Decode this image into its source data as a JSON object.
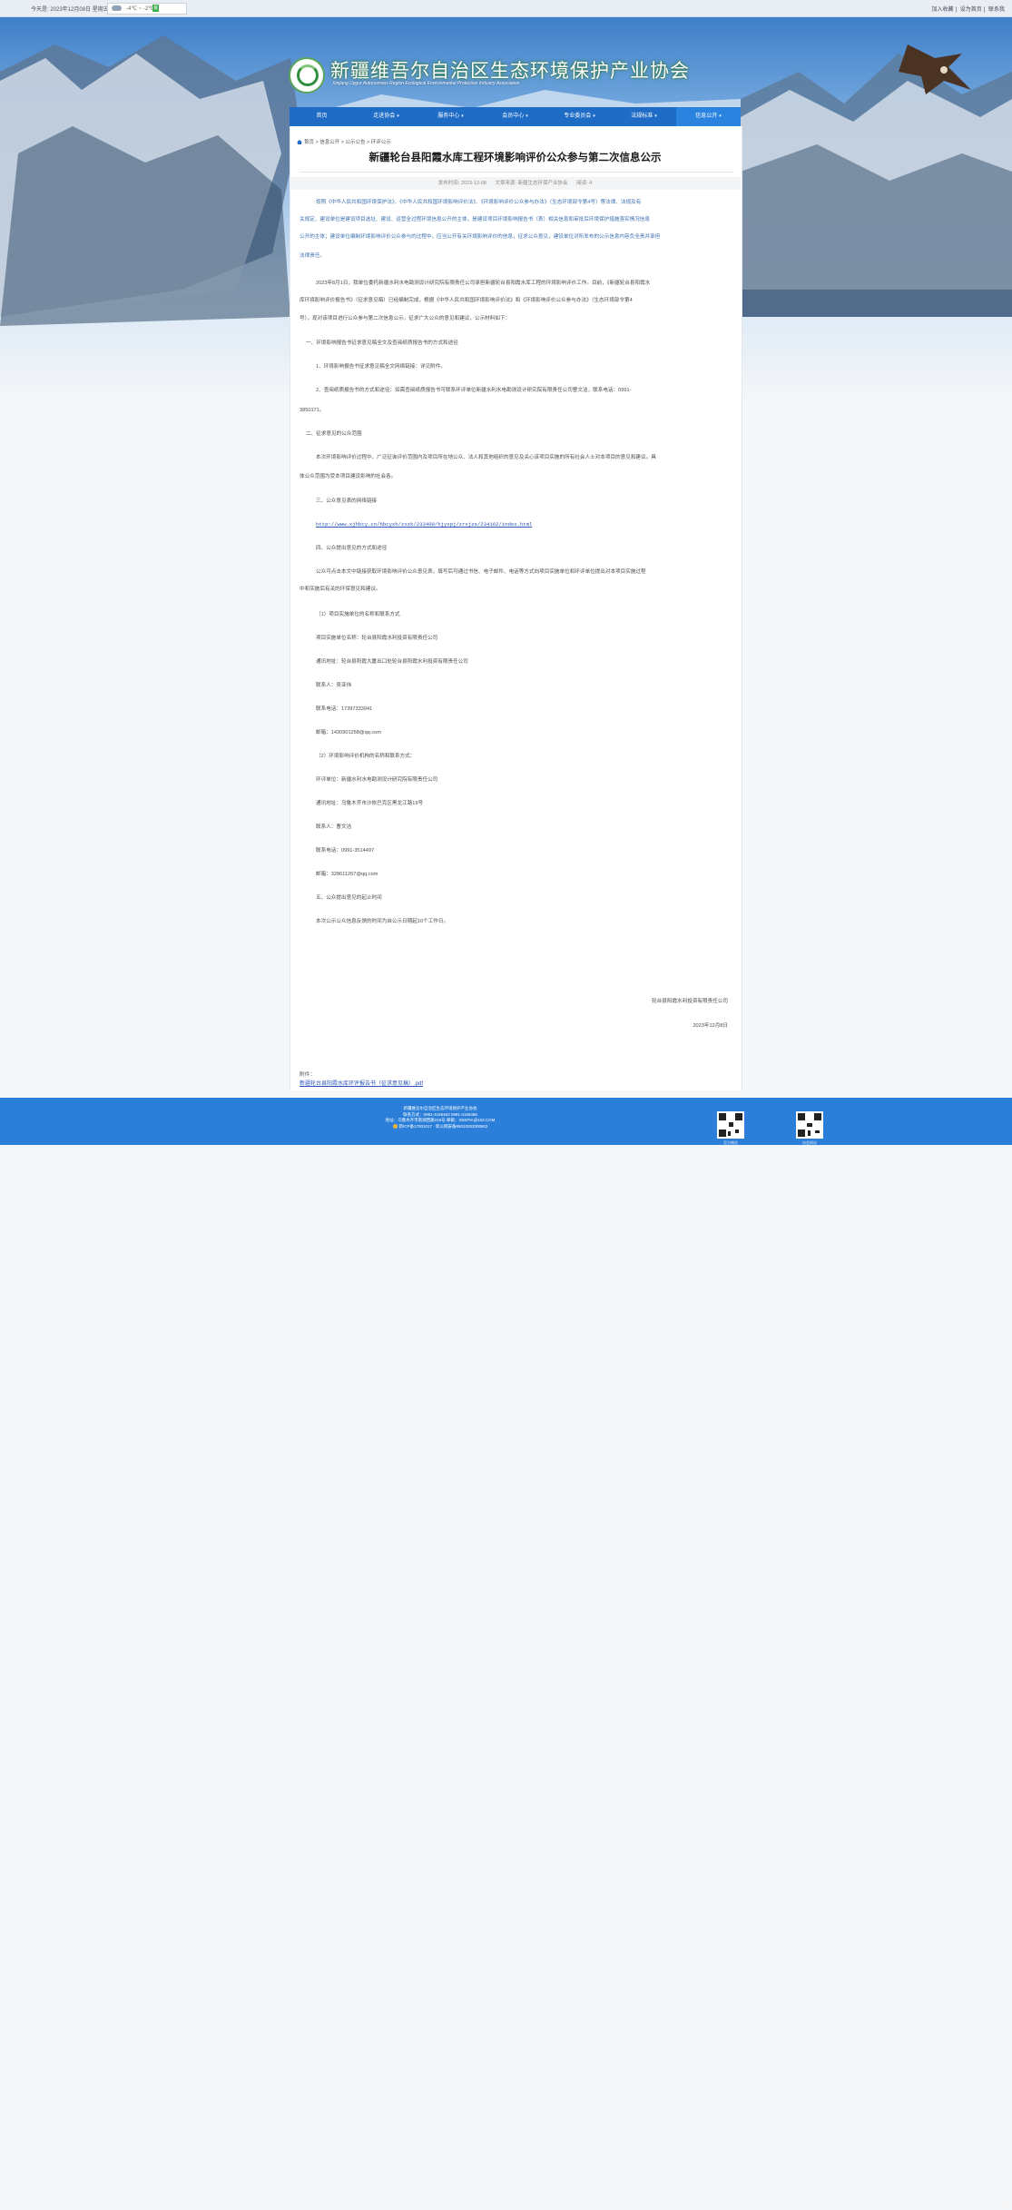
{
  "topbar": {
    "date": "今天是: 2023年12月08日 星期五",
    "temperature": "-4℃ ~ -2℃",
    "aqi_label": "良",
    "links": [
      "加入收藏",
      "设为首页",
      "联系我"
    ]
  },
  "header": {
    "title": "新疆维吾尔自治区生态环境保护产业协会",
    "subtitle": "Xinjiang Uygur Autonomous Region Ecological Environmental Protection Industry Association"
  },
  "nav": {
    "items": [
      {
        "label": "首页",
        "caret": ""
      },
      {
        "label": "走进协会",
        "caret": "▾"
      },
      {
        "label": "服务中心",
        "caret": "▾"
      },
      {
        "label": "会员中心",
        "caret": "▾"
      },
      {
        "label": "专业委员会",
        "caret": "▾"
      },
      {
        "label": "法规标准",
        "caret": "▾"
      },
      {
        "label": "信息公开",
        "caret": "▾"
      }
    ]
  },
  "breadcrumb": "首页 > 信息公开 > 公示公告 > 环评公示",
  "article": {
    "title": "新疆轮台县阳霞水库工程环境影响评价公众参与第二次信息公示",
    "meta": {
      "time": "发布时间: 2023-12-08",
      "source": "文章来源: 新疆生态环保产业协会",
      "views": "阅读: 4"
    },
    "paragraphs": [
      "按照《中华人民共和国环境保护法》、《中华人民共和国环境影响评价法》、《环境影响评价公众参与办法》（生态环境部令第4号）等法律、法规及有",
      "关规定，建设单位是建设项目选址、建设、运营全过程环境信息公开的主体，是建设项目环境影响报告书（表）相关信息和审批后环境保护措施落实情况信息",
      "公开的主体；建设单位编制环境影响评价公众参与的过程中，应当公开有关环境影响评价的信息，征求公众意见，建设单位对所发布的公示信息内容负全责并承担",
      "法律责任。",
      "2023年8月1日，我单位委托新疆水利水电勘测设计研究院有限责任公司承担新疆轮台县阳霞水库工程的环境影响评价工作。目前，《新疆轮台县阳霞水",
      "库环境影响评价报告书》（征求意见稿）已经编制完成，根据《中华人民共和国环境影响评价法》和《环境影响评价公众参与办法》（生态环境部令第4",
      "号），现对该项目进行公众参与第二次信息公示，征求广大公众的意见和建议，公示材料如下：",
      "一、环境影响报告书征求意见稿全文及查阅纸质报告书的方式和途径",
      "1、环境影响报告书征求意见稿全文网络链接：详见附件。",
      "2、查阅纸质报告书的方式和途径：如需查阅纸质报告书可联系环评单位新疆水利水电勘测设计研究院有限责任公司曹文洁，联系电话：0991-",
      "3850171。",
      "二、征求意见的公众范围",
      "本次环境影响评价过程中，广泛征询评价范围内及项目所在地公众、法人和其他组织的意见及关心该项目实施的所有社会人士对本项目的意见和建议。具",
      "体公众范围为受本项目建设影响的社会各。",
      "三、公众意见表的网络链接",
      "http://www.xjhbcy.cn/hbcyxh/zxzk/233400/hjyxpj/zrxjzs/234162/index.html",
      "四、公众提出意见的方式和途径",
      "公众可点击本文中链接获取环境影响评价公众意见表，填写后可通过书信、电子邮件、电话等方式向项目实施单位和环评单位提出对本项目实施过程",
      "中和实施后有关的环保意见和建议。",
      "（1）项目实施单位的名称和联系方式",
      "项目实施单位名称：轮台县阳霞水利投资有限责任公司",
      "通讯地址：轮台县阳霞大厦出口处轮台县阳霞水利投资有限责任公司",
      "联系人：吴亚伟",
      "联系电话：17397333941",
      "邮箱：1430901258@qq.com",
      "（2）环境影响评价机构的名称和联系方式：",
      "环评单位：新疆水利水电勘测设计研究院有限责任公司",
      "通讯地址：乌鲁木齐市沙依巴克区黑龙江路19号",
      "联系人：曹文洁",
      "联系电话：0991-3514497",
      "邮箱：328611267@qq.com",
      "五、公众提出意见的起止时间",
      "本次公示公众信息反馈的时间为自公示日期起10个工作日。"
    ],
    "signature": "轮台县阳霞水利投资有限责任公司",
    "date": "2023年12月8日",
    "attachment_label": "附件：",
    "attachment_link": "新疆轮台县阳霞水库环评报告书（征求意见稿）.pdf"
  },
  "footer": {
    "lines": [
      "新疆维吾尔自治区生态环境保护产业协会",
      "联系方式：0991-4165463 0991-4165486",
      "地址：乌鲁木齐市南湖西路215号 邮箱：XEEPIA@163.COM",
      "新ICP备17001017 · 新公网安备65010202000602"
    ],
    "qr_captions": [
      "官方微信",
      "协会网站"
    ],
    "totop": "↑"
  }
}
